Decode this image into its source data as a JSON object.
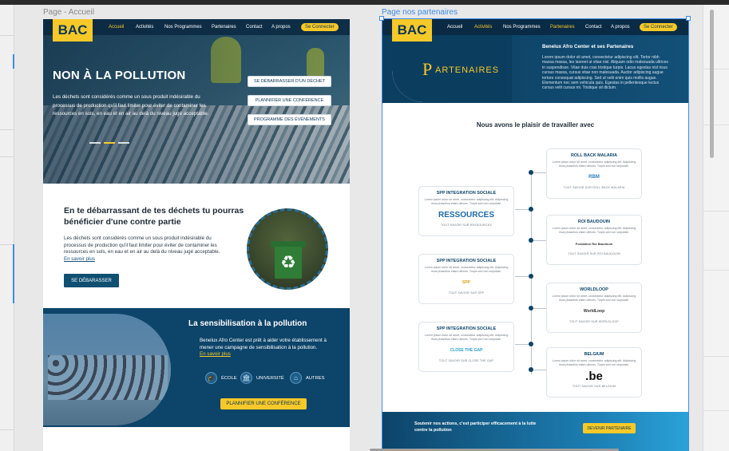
{
  "frames": {
    "accueil_label": "Page - Accueil",
    "partenaires_label": "Page nos partenaires"
  },
  "home": {
    "logo": "BAC",
    "nav": [
      "Accueil",
      "Activités",
      "Nos Programmes",
      "Partenaires",
      "Contact",
      "A propos"
    ],
    "nav_active": "Accueil",
    "connect": "Se Connecter",
    "hero": {
      "title": "NON À LA POLLUTION",
      "text": "Les déchets sont considérés comme un sous produit indésirable du processus de production qu'il faut limiter pour éviter de contaminer les ressources en sols, en eau et en air au delà du niveau jugé acceptable.",
      "buttons": [
        "SE DÉBARRASSER D'UN DÉCHET",
        "PLANNIFIER UNE CONFÉRENCE",
        "PROGRAMME DES ÉVÉNEMENTS"
      ]
    },
    "section2": {
      "title": "En te débarrassant de tes déchets tu pourras bénéficier d'une contre partie",
      "text": "Les déchets sont considérés comme un sous produit indésirable du processus de production qu'il faut limiter pour éviter de contaminer les ressources en sols, en eau et en air au delà du niveau jugé acceptable.",
      "link": "En savoir plus",
      "button": "SE DÉBARASSER"
    },
    "section3": {
      "title": "La sensibilisation à la pollution",
      "text": "Benelux Afro Center est prêt à aider votre établissement à mener une campagne de sensibilisation à la pollution.",
      "link": "En savoir plus",
      "categories": [
        "ÉCOLE",
        "UNIVERSITÉ",
        "AUTRES"
      ],
      "button": "PLANNIFIER UNE CONFÉRENCE"
    }
  },
  "partners": {
    "logo": "BAC",
    "nav": [
      "Accueil",
      "Activités",
      "Nos Programmes",
      "Partenaires",
      "Contact",
      "A propos"
    ],
    "nav_active": "Partenaires",
    "connect": "Se Connecter",
    "hero_big_letter": "P",
    "hero_word": "ARTENAIRES",
    "hero_title": "Benelux Afro Center et ses Partenaires",
    "hero_text": "Lorem ipsum dolor sit amet, consectetur adipiscing elit. Tortor nibh massa massa, leo laoreet ut vitae nisl. Aliquam odio malesuada ultrices in suspendisse. Vitae duis cras tristique turpis. Lacus egestas nisl risus cursus massa, cursus vitae non malesuada. Auctor adipiscing augue tortore consequat adipiscing. Sed ut velit enim quis mollis augue. Elementum nec sem vehicula quis. Egestas in pellentesque lectus cursus velit cursus mi. Tristique sit dictum.",
    "heading": "Nous avons le plaisir de travailler avec",
    "card_text": "Lorem ipsum dolor sit amet, consectetur adipiscing elit. Adipiscing risus phasellus etiam ultrices. Turpis sed non vulputate.",
    "left_cards": [
      {
        "title": "SPP INTEGRATION SOCIALE",
        "logo": "RESSOURCES",
        "link": "TOUT SAVOIR SUR RESSOURCES"
      },
      {
        "title": "SPP INTEGRATION SOCIALE",
        "logo": "SPP",
        "link": "TOUT SAVOIR SUR SPP"
      },
      {
        "title": "SPP INTEGRATION SOCIALE",
        "logo": "CLOSE THE GAP",
        "link": "TOUT SAVOIR SUR CLOSE THE GAP"
      }
    ],
    "right_cards": [
      {
        "title": "ROLL BACK MALARIA",
        "logo": "RBM",
        "link": "TOUT SAVOIR SUR ROLL BACK MALARIA"
      },
      {
        "title": "ROI BAUDOUIN",
        "logo": "Fondation Roi Baudouin",
        "link": "TOUT SAVOIR SUR ROI BAUDOUIN"
      },
      {
        "title": "WORLDLOOP",
        "logo": "WorldLoop",
        "link": "TOUT SAVOIR SUR WORLDLOOP"
      },
      {
        "title": "BELGIUM",
        "logo": ".be",
        "link": "TOUT SAVOIR SUR BELGIUM"
      }
    ],
    "footer_text": "Soutenir nos actions, c'est participer efficacement à la lutte contre la pollution",
    "footer_button": "DEVENIR PARTENAIRE"
  }
}
